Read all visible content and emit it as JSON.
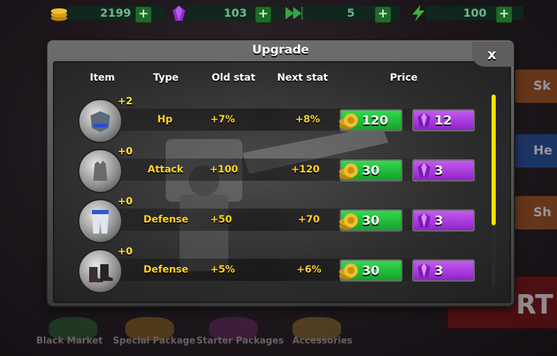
{
  "topbar": {
    "coins": "2199",
    "gems": "103",
    "skips": "5",
    "energy": "100",
    "coin_icon": "coin-stack-icon",
    "gem_icon": "purple-gem-icon",
    "skip_icon": "fast-forward-icon",
    "energy_icon": "lightning-icon",
    "plus_label": "+"
  },
  "dialog": {
    "title": "Upgrade",
    "close_label": "x",
    "headers": {
      "item": "Item",
      "type": "Type",
      "old_stat": "Old stat",
      "next_stat": "Next stat",
      "price": "Price"
    },
    "rows": [
      {
        "icon": "armor-icon",
        "level": "+2",
        "type": "Hp",
        "old": "+7%",
        "next": "+8%",
        "gold": "120",
        "gem": "12"
      },
      {
        "icon": "gauntlet-icon",
        "level": "+0",
        "type": "Attack",
        "old": "+100",
        "next": "+120",
        "gold": "30",
        "gem": "3"
      },
      {
        "icon": "pants-icon",
        "level": "+0",
        "type": "Defense",
        "old": "+50",
        "next": "+70",
        "gold": "30",
        "gem": "3"
      },
      {
        "icon": "boots-icon",
        "level": "+0",
        "type": "Defense",
        "old": "+5%",
        "next": "+6%",
        "gold": "30",
        "gem": "3"
      }
    ]
  },
  "side": {
    "tab1": "Sk",
    "tab2": "He",
    "tab3": "Sh",
    "bigbutton": "RT"
  },
  "bottomnav": {
    "items": [
      "Black Market",
      "Special Package",
      "Starter Packages",
      "Accessories"
    ]
  },
  "colors": {
    "stat_yellow": "#ffd21f",
    "gold_button": "#14a12c",
    "gem_button": "#8f22c9",
    "scroll_thumb": "#ffe000"
  }
}
